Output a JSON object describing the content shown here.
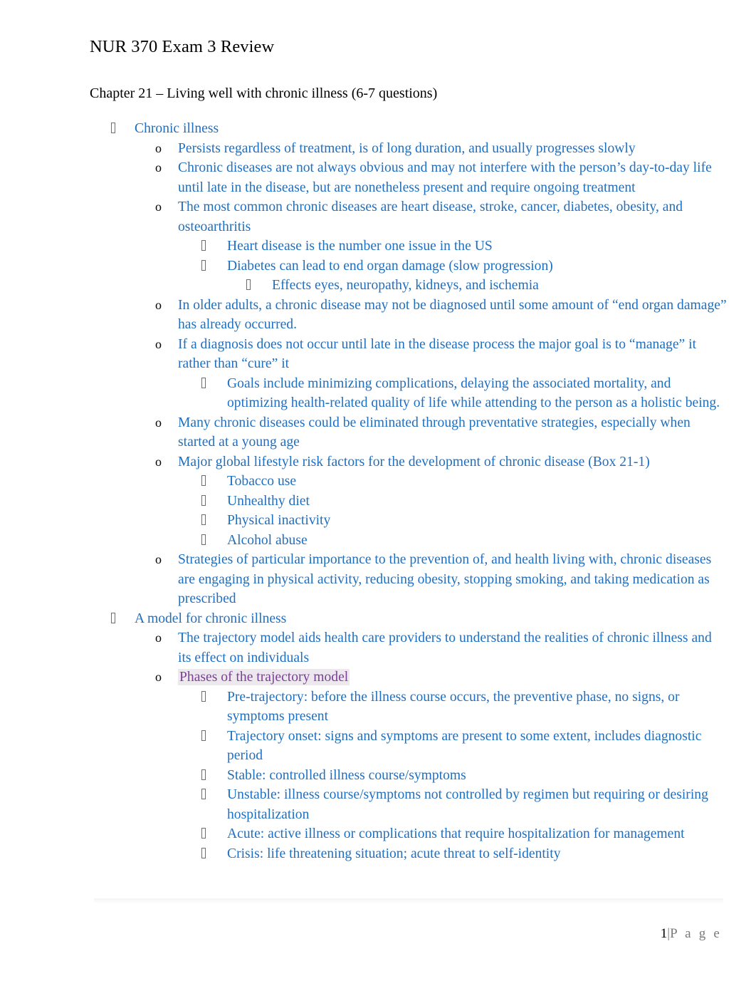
{
  "document": {
    "title": "NUR 370 Exam 3 Review",
    "chapter_heading": "Chapter 21 – Living well with chronic illness (6-7 questions)"
  },
  "colors": {
    "body_text": "#1F6FC0",
    "heading_text": "#000000",
    "highlight_text": "#7B3F96",
    "highlight_background": "#ece8ee",
    "footer_text": "#7a7a7a"
  },
  "outline": [
    {
      "level": 1,
      "marker": "wingding-box-bullet",
      "text": "Chronic illness"
    },
    {
      "level": 2,
      "marker": "o",
      "text": "Persists regardless of treatment, is of long duration, and usually progresses slowly"
    },
    {
      "level": 2,
      "marker": "o",
      "text": "Chronic diseases are not always obvious and may not interfere with the person’s day-to-day life until late in the disease, but are nonetheless present and require ongoing treatment"
    },
    {
      "level": 2,
      "marker": "o",
      "text": "The most common chronic diseases are heart disease, stroke, cancer, diabetes, obesity, and osteoarthritis"
    },
    {
      "level": 3,
      "marker": "wingding-box-bullet",
      "text": "Heart disease is the number one issue in the US"
    },
    {
      "level": 3,
      "marker": "wingding-box-bullet",
      "text": "Diabetes can lead to end organ damage (slow progression)"
    },
    {
      "level": 4,
      "marker": "wingding-box-bullet",
      "text": "Effects eyes, neuropathy, kidneys, and ischemia"
    },
    {
      "level": 2,
      "marker": "o",
      "text": "In older adults, a chronic disease may not be diagnosed until some amount of “end organ damage” has already occurred."
    },
    {
      "level": 2,
      "marker": "o",
      "text": "If a diagnosis does not occur until late in the disease process the major goal is to “manage” it rather than “cure” it"
    },
    {
      "level": 3,
      "marker": "wingding-box-bullet",
      "text": "Goals include minimizing complications, delaying the associated mortality, and optimizing health-related quality of life while attending to the person as a holistic being."
    },
    {
      "level": 2,
      "marker": "o",
      "text": "Many chronic diseases could be eliminated through preventative strategies, especially when started at a young age"
    },
    {
      "level": 2,
      "marker": "o",
      "text": "Major global lifestyle risk factors for the development of chronic disease (Box 21-1)"
    },
    {
      "level": 3,
      "marker": "wingding-box-bullet",
      "text": "Tobacco use"
    },
    {
      "level": 3,
      "marker": "wingding-box-bullet",
      "text": "Unhealthy diet"
    },
    {
      "level": 3,
      "marker": "wingding-box-bullet",
      "text": "Physical inactivity"
    },
    {
      "level": 3,
      "marker": "wingding-box-bullet",
      "text": "Alcohol abuse"
    },
    {
      "level": 2,
      "marker": "o",
      "text": "Strategies of particular importance to the prevention of, and health living with, chronic diseases are engaging in physical activity, reducing obesity, stopping smoking, and taking medication as prescribed"
    },
    {
      "level": 1,
      "marker": "wingding-box-bullet",
      "text": "A model for chronic illness"
    },
    {
      "level": 2,
      "marker": "o",
      "text": "The trajectory model aids health care providers to understand the realities of chronic illness and its effect on individuals"
    },
    {
      "level": 2,
      "marker": "o",
      "highlighted": true,
      "text": "Phases of the trajectory model"
    },
    {
      "level": 3,
      "marker": "wingding-box-bullet",
      "text": "Pre-trajectory: before the illness course occurs, the preventive phase, no signs, or symptoms present"
    },
    {
      "level": 3,
      "marker": "wingding-box-bullet",
      "text": "Trajectory onset: signs and symptoms are present to some extent, includes diagnostic period"
    },
    {
      "level": 3,
      "marker": "wingding-box-bullet",
      "text": "Stable: controlled illness course/symptoms"
    },
    {
      "level": 3,
      "marker": "wingding-box-bullet",
      "text": "Unstable: illness course/symptoms not controlled by regimen but requiring or desiring hospitalization"
    },
    {
      "level": 3,
      "marker": "wingding-box-bullet",
      "text": "Acute: active illness or complications that require hospitalization for management"
    },
    {
      "level": 3,
      "marker": "wingding-box-bullet",
      "text": "Crisis: life threatening situation; acute threat to self-identity"
    }
  ],
  "footer": {
    "page_number": "1",
    "separator": "|",
    "page_word": "P a g e"
  }
}
